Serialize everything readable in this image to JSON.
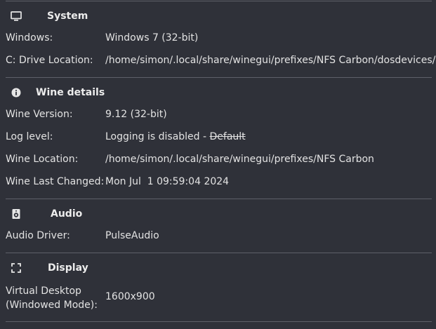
{
  "system": {
    "title": "System",
    "icon": "monitor-icon",
    "windows_label": "Windows:",
    "windows_value": "Windows 7 (32-bit)",
    "cdrive_label": "C: Drive Location:",
    "cdrive_value": "/home/simon/.local/share/winegui/prefixes/NFS Carbon/dosdevices/c:"
  },
  "wine": {
    "title": "Wine details",
    "icon": "info-icon",
    "version_label": "Wine Version:",
    "version_value": "9.12 (32-bit)",
    "log_label": "Log level:",
    "log_value": "Logging is disabled - ",
    "log_default": "Default",
    "location_label": "Wine Location:",
    "location_value": "/home/simon/.local/share/winegui/prefixes/NFS Carbon",
    "changed_label": "Wine Last Changed:",
    "changed_value": "Mon Jul  1 09:59:04 2024"
  },
  "audio": {
    "title": "Audio",
    "icon": "speaker-icon",
    "driver_label": "Audio Driver:",
    "driver_value": "PulseAudio"
  },
  "display": {
    "title": "Display",
    "icon": "fullscreen-icon",
    "vd_label_line1": "Virtual Desktop",
    "vd_label_line2": "(Windowed Mode):",
    "vd_value": "1600x900"
  }
}
